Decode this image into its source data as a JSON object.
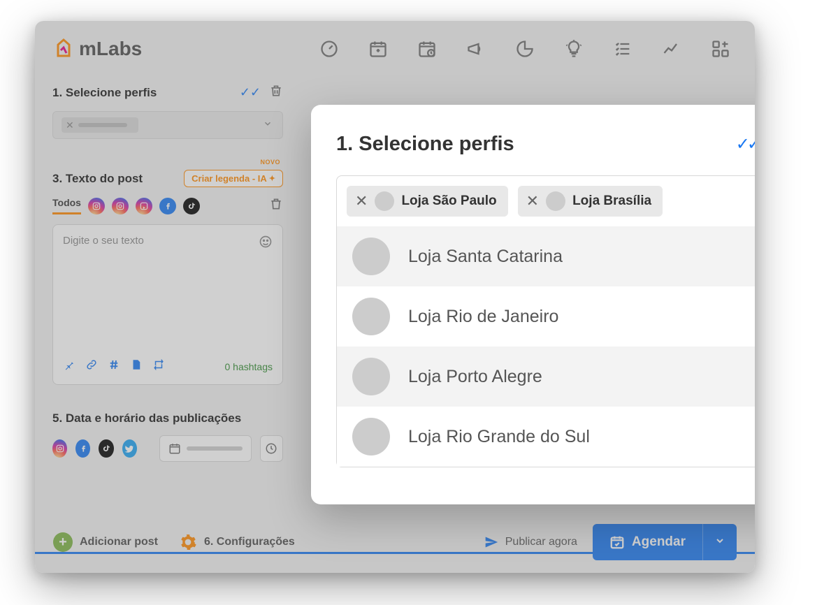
{
  "brand": "mLabs",
  "left_panel": {
    "section1_title": "1. Selecione perfis",
    "section3_title": "3. Texto do post",
    "section3_badge": "NOVO",
    "section3_ia_button": "Criar legenda - IA",
    "tab_todos": "Todos",
    "textarea_placeholder": "Digite o seu texto",
    "hashtag_count": "0 hashtags",
    "section5_title": "5. Data e horário das publicações"
  },
  "footer": {
    "add_post": "Adicionar post",
    "config": "6. Configurações",
    "publish_now": "Publicar agora",
    "agendar": "Agendar"
  },
  "popup": {
    "title": "1. Selecione perfis",
    "chips": [
      {
        "label": "Loja São Paulo"
      },
      {
        "label": "Loja Brasília"
      }
    ],
    "options": [
      {
        "label": "Loja Santa Catarina"
      },
      {
        "label": "Loja Rio de Janeiro"
      },
      {
        "label": "Loja Porto Alegre"
      },
      {
        "label": "Loja Rio Grande do Sul"
      }
    ]
  }
}
